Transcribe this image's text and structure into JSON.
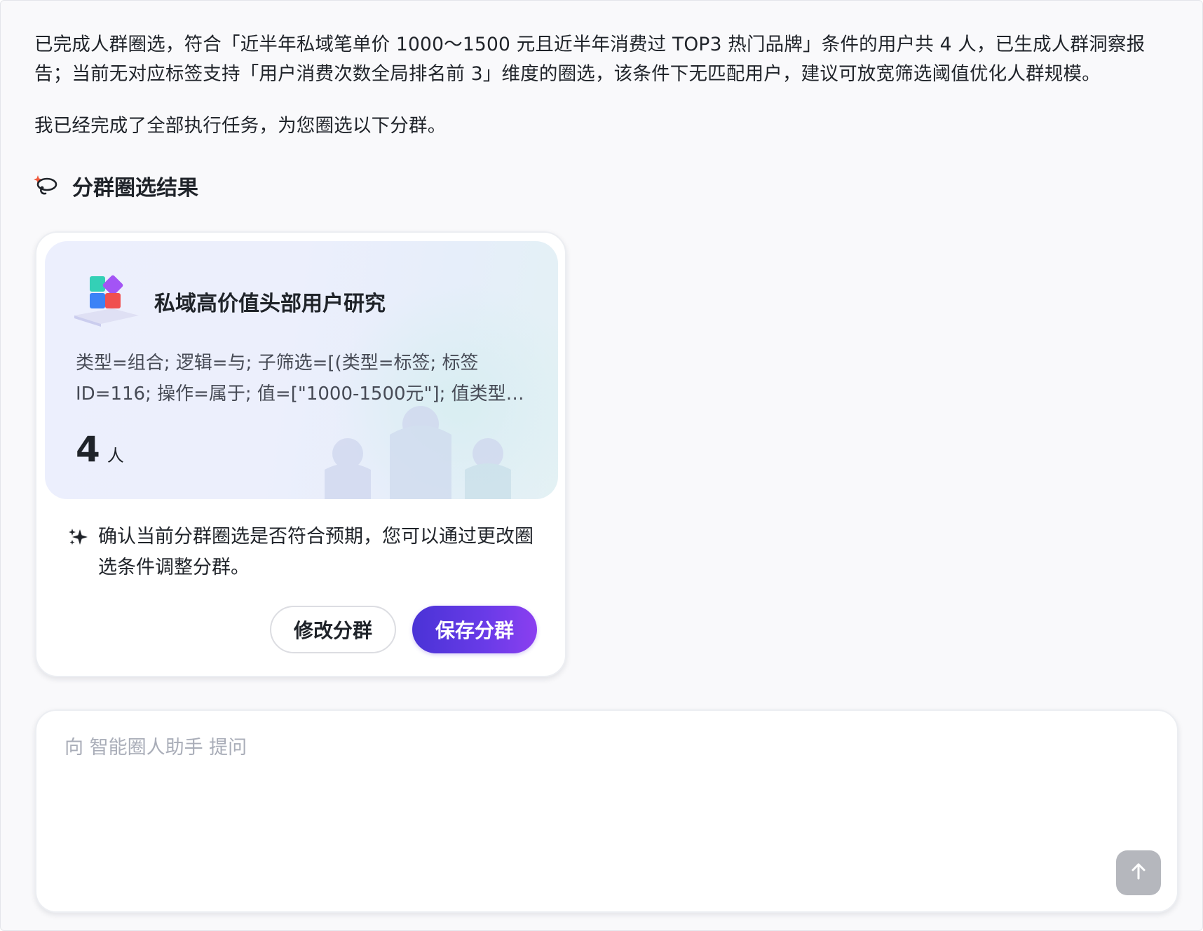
{
  "messages": {
    "summary": "已完成人群圈选，符合「近半年私域笔单价 1000～1500 元且近半年消费过 TOP3 热门品牌」条件的用户共 4 人，已生成人群洞察报告；当前无对应标签支持「用户消费次数全局排名前 3」维度的圈选，该条件下无匹配用户，建议可放宽筛选阈值优化人群规模。",
    "done": "我已经完成了全部执行任务，为您圈选以下分群。"
  },
  "section": {
    "title": "分群圈选结果",
    "icon": "ai-lasso-icon"
  },
  "segment_card": {
    "name": "私域高价值头部用户研究",
    "description": "类型=组合; 逻辑=与; 子筛选=[(类型=标签; 标签ID=116; 操作=属于; 值=[\"1000-1500元\"]; 值类型=字符串)...",
    "count": "4",
    "count_unit": "人",
    "tip": "确认当前分群圈选是否符合预期，您可以通过更改圈选条件调整分群。",
    "modify_label": "修改分群",
    "save_label": "保存分群"
  },
  "composer": {
    "placeholder": "向 智能圈人助手 提问",
    "send_icon": "arrow-up-icon"
  },
  "colors": {
    "accent_start": "#4a33d6",
    "accent_end": "#8b3ff0",
    "send_disabled": "#b5b7bd"
  }
}
